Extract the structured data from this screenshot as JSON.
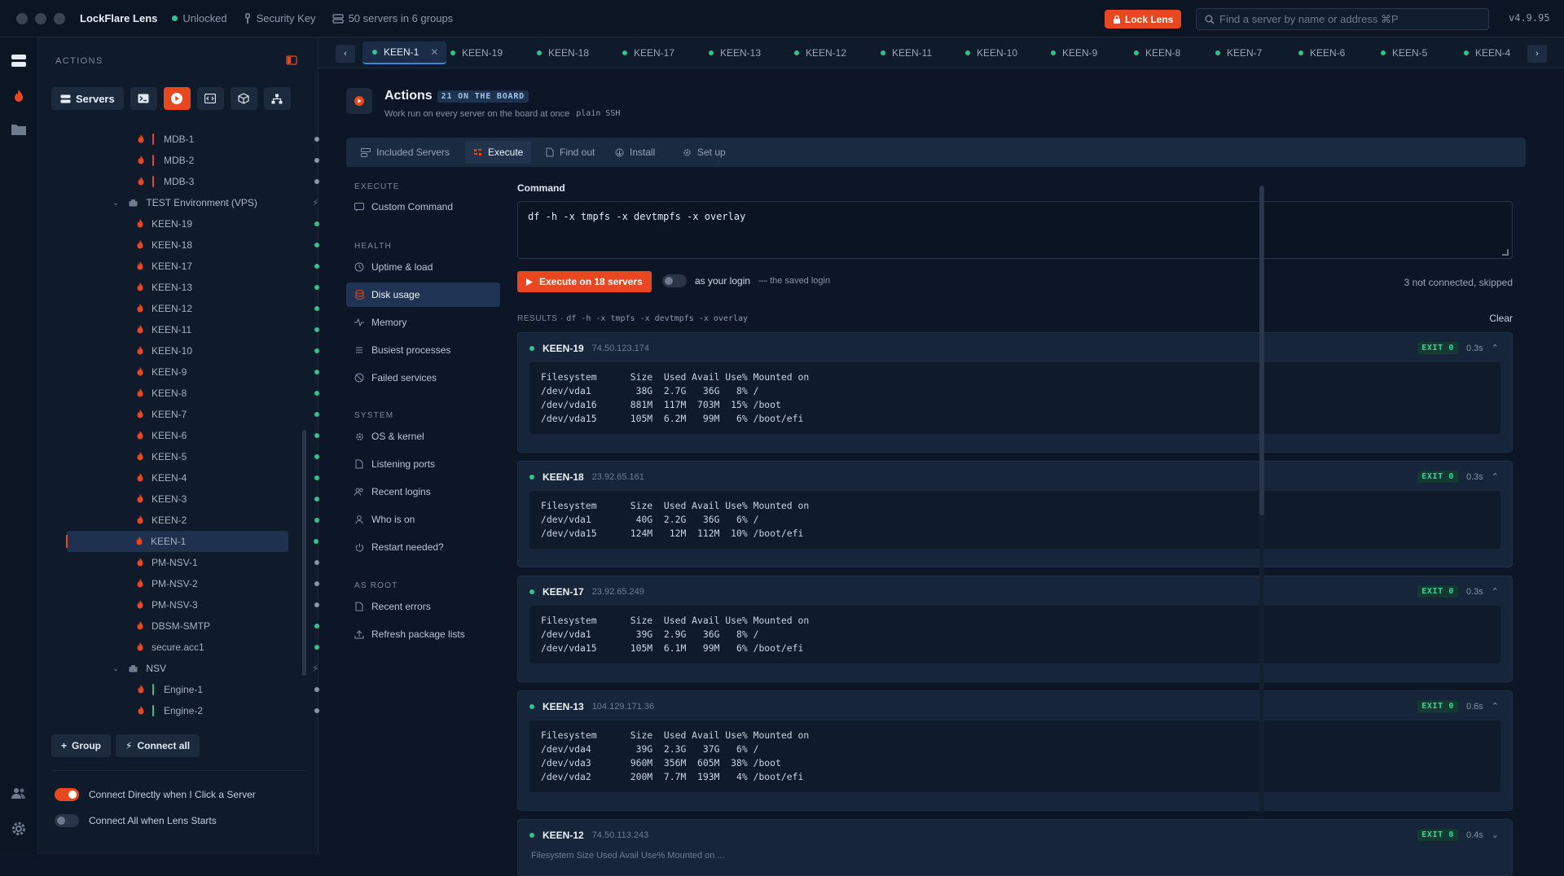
{
  "titlebar": {
    "app_name": "LockFlare Lens",
    "lock_status": "Unlocked",
    "key_label": "Security Key",
    "servers_summary": "50 servers in 6 groups",
    "lock_button": "Lock Lens",
    "search_placeholder": "Find a server by name or address ⌘P",
    "version": "v4.9.95"
  },
  "sidebar": {
    "heading": "ACTIONS",
    "servers_tool": "Servers",
    "tree": [
      {
        "type": "server",
        "label": "MDB-1",
        "bar": "#e8471f",
        "status": "grey",
        "indent": 1
      },
      {
        "type": "server",
        "label": "MDB-2",
        "bar": "#e8471f",
        "status": "grey",
        "indent": 1
      },
      {
        "type": "server",
        "label": "MDB-3",
        "bar": "#e8471f",
        "status": "grey",
        "indent": 1
      },
      {
        "type": "group",
        "label": "TEST Environment (VPS)"
      },
      {
        "type": "server",
        "label": "KEEN-19",
        "status": "green"
      },
      {
        "type": "server",
        "label": "KEEN-18",
        "status": "green"
      },
      {
        "type": "server",
        "label": "KEEN-17",
        "status": "green"
      },
      {
        "type": "server",
        "label": "KEEN-13",
        "status": "green"
      },
      {
        "type": "server",
        "label": "KEEN-12",
        "status": "green"
      },
      {
        "type": "server",
        "label": "KEEN-11",
        "status": "green"
      },
      {
        "type": "server",
        "label": "KEEN-10",
        "status": "green"
      },
      {
        "type": "server",
        "label": "KEEN-9",
        "status": "green"
      },
      {
        "type": "server",
        "label": "KEEN-8",
        "status": "green"
      },
      {
        "type": "server",
        "label": "KEEN-7",
        "status": "green"
      },
      {
        "type": "server",
        "label": "KEEN-6",
        "status": "green"
      },
      {
        "type": "server",
        "label": "KEEN-5",
        "status": "green"
      },
      {
        "type": "server",
        "label": "KEEN-4",
        "status": "green"
      },
      {
        "type": "server",
        "label": "KEEN-3",
        "status": "green"
      },
      {
        "type": "server",
        "label": "KEEN-2",
        "status": "green"
      },
      {
        "type": "server",
        "label": "KEEN-1",
        "status": "green",
        "selected": true
      },
      {
        "type": "server",
        "label": "PM-NSV-1",
        "status": "grey"
      },
      {
        "type": "server",
        "label": "PM-NSV-2",
        "status": "grey"
      },
      {
        "type": "server",
        "label": "PM-NSV-3",
        "status": "grey"
      },
      {
        "type": "server",
        "label": "DBSM-SMTP",
        "status": "green"
      },
      {
        "type": "server",
        "label": "secure.acc1",
        "status": "green"
      },
      {
        "type": "group",
        "label": "NSV"
      },
      {
        "type": "server",
        "label": "Engine-1",
        "bar": "#2fc48d",
        "status": "grey",
        "indent": 1
      },
      {
        "type": "server",
        "label": "Engine-2",
        "bar": "#2fc48d",
        "status": "grey",
        "indent": 1
      }
    ],
    "group_button": "Group",
    "connect_all_button": "Connect all",
    "toggle_connect_direct": "Connect Directly when I Click a Server",
    "toggle_connect_all": "Connect All when Lens Starts"
  },
  "tabs": [
    "KEEN-1",
    "KEEN-19",
    "KEEN-18",
    "KEEN-17",
    "KEEN-13",
    "KEEN-12",
    "KEEN-11",
    "KEEN-10",
    "KEEN-9",
    "KEEN-8",
    "KEEN-7",
    "KEEN-6",
    "KEEN-5",
    "KEEN-4"
  ],
  "actions": {
    "title": "Actions",
    "badge": "21 ON THE BOARD",
    "subtitle": "Work run on every server on the board at once",
    "subtitle_tag": "plain SSH",
    "subtabs": [
      "Included Servers",
      "Execute",
      "Find out",
      "Install",
      "Set up"
    ],
    "nav": {
      "execute_heading": "EXECUTE",
      "custom_command": "Custom Command",
      "health_heading": "HEALTH",
      "uptime": "Uptime & load",
      "disk": "Disk usage",
      "memory": "Memory",
      "processes": "Busiest processes",
      "failed": "Failed services",
      "system_heading": "SYSTEM",
      "os": "OS & kernel",
      "ports": "Listening ports",
      "logins": "Recent logins",
      "who": "Who is on",
      "restart": "Restart needed?",
      "root_heading": "AS ROOT",
      "errors": "Recent errors",
      "refresh": "Refresh package lists"
    },
    "command_label": "Command",
    "command": "df -h -x tmpfs -x devtmpfs -x overlay",
    "execute_button": "Execute on 18 servers",
    "as_login": "as your login",
    "as_login_note": "— the saved login",
    "skip_note": "3 not connected, skipped",
    "results_heading": "RESULTS · ",
    "results_command": "df -h -x tmpfs -x devtmpfs -x overlay",
    "clear": "Clear"
  },
  "results": [
    {
      "name": "KEEN-19",
      "ip": "74.50.123.174",
      "exit": "EXIT 0",
      "time": "0.3s",
      "output": "Filesystem      Size  Used Avail Use% Mounted on\n/dev/vda1        38G  2.7G   36G   8% /\n/dev/vda16      881M  117M  703M  15% /boot\n/dev/vda15      105M  6.2M   99M   6% /boot/efi"
    },
    {
      "name": "KEEN-18",
      "ip": "23.92.65.161",
      "exit": "EXIT 0",
      "time": "0.3s",
      "output": "Filesystem      Size  Used Avail Use% Mounted on\n/dev/vda1        40G  2.2G   36G   6% /\n/dev/vda15      124M   12M  112M  10% /boot/efi"
    },
    {
      "name": "KEEN-17",
      "ip": "23.92.65.249",
      "exit": "EXIT 0",
      "time": "0.3s",
      "output": "Filesystem      Size  Used Avail Use% Mounted on\n/dev/vda1        39G  2.9G   36G   8% /\n/dev/vda15      105M  6.1M   99M   6% /boot/efi"
    },
    {
      "name": "KEEN-13",
      "ip": "104.129.171.36",
      "exit": "EXIT 0",
      "time": "0.6s",
      "output": "Filesystem      Size  Used Avail Use% Mounted on\n/dev/vda4        39G  2.3G   37G   6% /\n/dev/vda3       960M  356M  605M  38% /boot\n/dev/vda2       200M  7.7M  193M   4% /boot/efi"
    },
    {
      "name": "KEEN-12",
      "ip": "74.50.113.243",
      "exit": "EXIT 0",
      "time": "0.4s",
      "output": "Filesystem Size Used Avail Use% Mounted on ..."
    }
  ]
}
